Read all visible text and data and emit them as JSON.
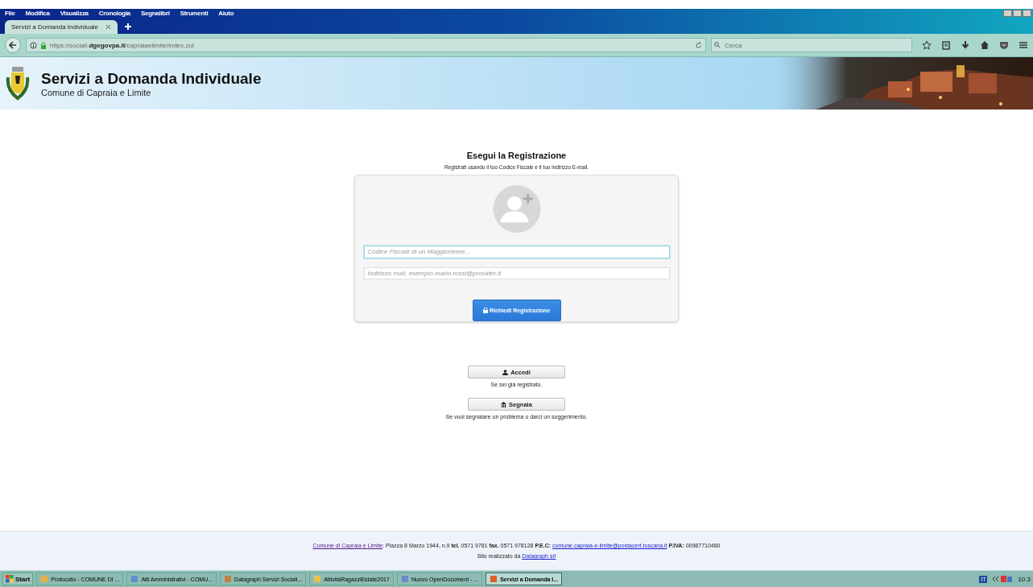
{
  "window_controls": {
    "kind": "classic"
  },
  "menu": [
    "File",
    "Modifica",
    "Visualizza",
    "Cronologia",
    "Segnalibri",
    "Strumenti",
    "Aiuto"
  ],
  "tabs": [
    {
      "label": "Servizi a Domanda Individuale",
      "selected": true
    }
  ],
  "address_bar": {
    "url_prefix": "https://sociali.",
    "url_domain": "dgegovpa.it",
    "url_path": "/capraiaelimite/index.zul"
  },
  "search": {
    "placeholder": "Cerca"
  },
  "header": {
    "title": "Servizi a Domanda Individuale",
    "subtitle": "Comune di Capraia e Limite"
  },
  "registration": {
    "title": "Esegui la Registrazione",
    "subtitle": "Registrati usando il tuo Codice Fiscale e il tuo indirizzo E-mail.",
    "fields": [
      {
        "placeholder": "Codice Fiscale di un Maggiorenne...",
        "focused": true
      },
      {
        "placeholder": "Indirizzo mail, esempio mario.rossi@provider.it",
        "focused": false
      }
    ],
    "button": "Richiedi Registrazione"
  },
  "actions": [
    {
      "kind": "login",
      "label": "Accedi",
      "note": "Se sei già registrato."
    },
    {
      "kind": "report",
      "label": "Segnala",
      "note": "Se vuoi segnalare un problema o darci un suggerimento."
    }
  ],
  "footer": {
    "lines": [
      [
        {
          "kind": "link",
          "text": "Comune di Capraia e Limite",
          "visited": true
        },
        {
          "kind": "text",
          "text": ": Piazza 8 Marzo 1944, n.9 **tel.** 0571 9781 **fax.** 0571 978128 **P.E.C:** "
        },
        {
          "kind": "link",
          "text": "comune.capraia-e-limite@postacert.toscana.it",
          "visited": false
        },
        {
          "kind": "text",
          "text": " **P.IVA:** 00987710480"
        }
      ],
      [
        {
          "kind": "text",
          "text": "Sito realizzato da "
        },
        {
          "kind": "link",
          "text": "Datagraph srl",
          "visited": false
        }
      ]
    ]
  },
  "taskbar": {
    "start": "Start",
    "items": [
      {
        "label": "Protocollo - COMUNE DI ...",
        "selected": false
      },
      {
        "label": "Atti Amministrativi - COMU...",
        "selected": false
      },
      {
        "label": "Datagraph Servizi Sociali...",
        "selected": false
      },
      {
        "label": "AttivitàRagazziEstate2017",
        "selected": false
      },
      {
        "label": "Nuovo OpenDocument - ...",
        "selected": false
      },
      {
        "label": "Servizi a Domanda I...",
        "selected": true
      }
    ],
    "language": "IT",
    "clock": "10.3"
  }
}
